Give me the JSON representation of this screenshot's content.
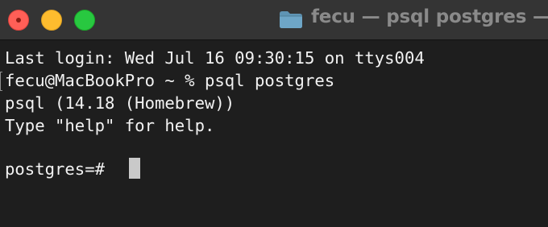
{
  "window": {
    "title": "fecu — psql postgres —"
  },
  "terminal": {
    "lines": [
      "Last login: Wed Jul 16 09:30:15 on ttys004",
      "fecu@MacBookPro ~ % psql postgres",
      "psql (14.18 (Homebrew))",
      "Type \"help\" for help."
    ],
    "prompt": "postgres=# "
  },
  "icons": {
    "title_icon": "folder-icon"
  },
  "colors": {
    "titlebar": "#343434",
    "background": "#1e1e1e",
    "text": "#f2f2f2",
    "close": "#ff5f57",
    "minimize": "#febc2e",
    "zoom": "#28c840",
    "folder": "#5f94b4",
    "cursor": "#c9c9c9"
  }
}
